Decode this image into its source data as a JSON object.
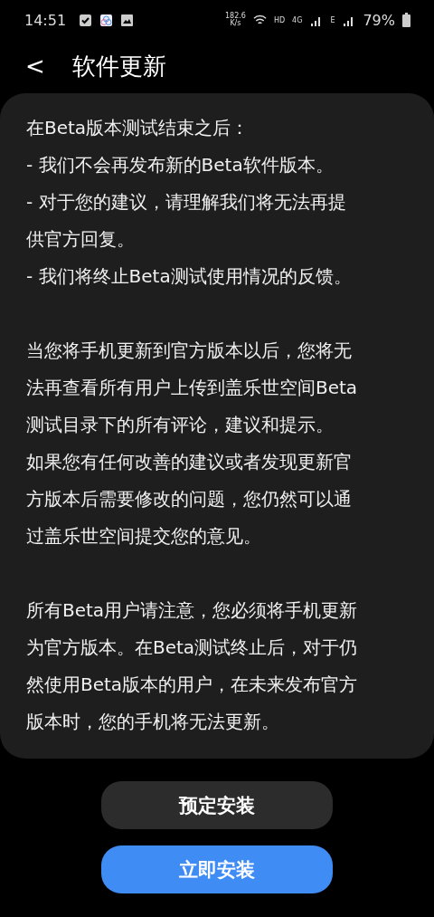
{
  "status_bar": {
    "time": "14:51",
    "net_speed": "182.6",
    "net_unit": "K/s",
    "hd": "HD",
    "network_1": "4G",
    "network_2": "E",
    "battery": "79%"
  },
  "header": {
    "back": "<",
    "title": "软件更新"
  },
  "notice": {
    "paragraphs": [
      {
        "lines": [
          "在Beta版本测试结束之后：",
          "- 我们不会再发布新的Beta软件版本。",
          "- 对于您的建议，请理解我们将无法再提",
          "供官方回复。",
          "- 我们将终止Beta测试使用情况的反馈。"
        ]
      },
      {
        "lines": [
          "当您将手机更新到官方版本以后，您将无",
          "法再查看所有用户上传到盖乐世空间Beta",
          "测试目录下的所有评论，建议和提示。",
          "如果您有任何改善的建议或者发现更新官",
          "方版本后需要修改的问题，您仍然可以通",
          "过盖乐世空间提交您的意见。"
        ]
      },
      {
        "lines": [
          "所有Beta用户请注意，您必须将手机更新",
          "为官方版本。在Beta测试终止后，对于仍",
          "然使用Beta版本的用户，在未来发布官方",
          "版本时，您的手机将无法更新。"
        ]
      }
    ]
  },
  "buttons": [
    {
      "label": "预定安装",
      "kind": "secondary"
    },
    {
      "label": "立即安装",
      "kind": "primary"
    }
  ]
}
